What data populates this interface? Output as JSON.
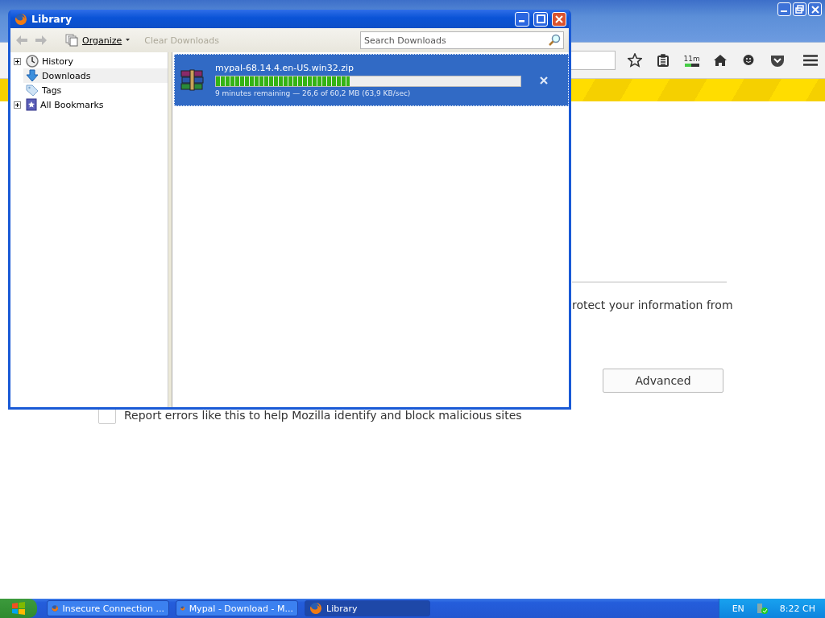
{
  "browser": {
    "toolbar": {
      "timer_badge": {
        "label": "11m",
        "level": 0.45
      }
    },
    "page": {
      "text_fragment": "rotect your information from",
      "advanced_button": "Advanced",
      "report_checkbox": {
        "label": "Report errors like this to help Mozilla identify and block malicious sites",
        "checked": false
      }
    }
  },
  "library": {
    "title": "Library",
    "toolbar": {
      "organize": "Organize",
      "clear_downloads": {
        "label": "Clear Downloads",
        "disabled": true
      }
    },
    "search": {
      "placeholder": "Search Downloads"
    },
    "sidebar": {
      "items": [
        {
          "label": "History",
          "kind": "history",
          "expandable": true,
          "selected": false
        },
        {
          "label": "Downloads",
          "kind": "downloads",
          "expandable": false,
          "selected": true
        },
        {
          "label": "Tags",
          "kind": "tags",
          "expandable": false,
          "selected": false
        },
        {
          "label": "All Bookmarks",
          "kind": "bookmarks",
          "expandable": true,
          "selected": false
        }
      ]
    },
    "downloads": [
      {
        "file_name": "mypal-68.14.4.en-US.win32.zip",
        "level": 0.44,
        "status": "9 minutes remaining — 26,6 of 60,2 MB (63,9 KB/sec)",
        "selected": true
      }
    ]
  },
  "taskbar": {
    "items": [
      {
        "label": "Insecure Connection ...",
        "selected": false
      },
      {
        "label": "Mypal - Download - M...",
        "selected": false
      },
      {
        "label": "Library",
        "selected": true
      }
    ],
    "language": "EN",
    "clock": "8:22 CH"
  }
}
